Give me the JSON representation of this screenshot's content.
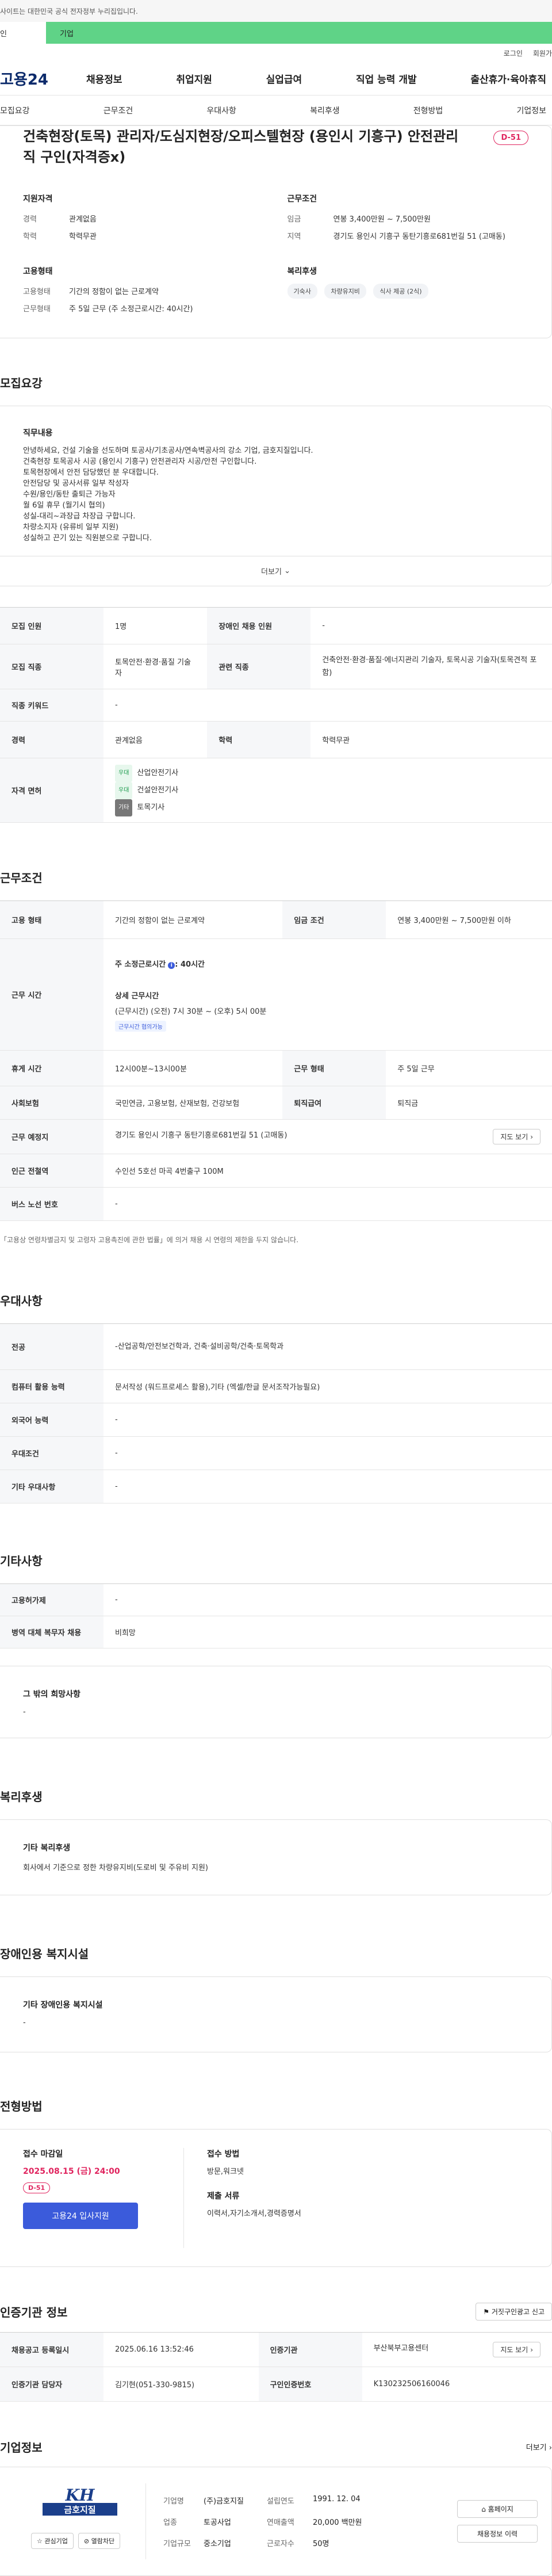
{
  "gov_banner": "사이트는 대한민국 공식 전자정부 누리집입니다.",
  "user_tabs": {
    "personal": "인",
    "corp": "기업"
  },
  "util_links": [
    "로그인",
    "회원가"
  ],
  "logo": "고용24",
  "gnb": [
    "채용정보",
    "취업지원",
    "실업급여",
    "직업 능력 개발",
    "출산휴가·육아휴직"
  ],
  "anchors": [
    "모집요강",
    "근무조건",
    "우대사항",
    "복리후생",
    "전형방법",
    "기업정보"
  ],
  "job": {
    "title": "건축현장(토목) 관리자/도심지현장/오피스텔현장 (용인시 기흥구) 안전관리직 구인(자격증x)",
    "dday": "D-51",
    "qualification_title": "지원자격",
    "career_label": "경력",
    "career_value": "관계없음",
    "edu_label": "학력",
    "edu_value": "학력무관",
    "conditions_title": "근무조건",
    "wage_label": "임금",
    "wage_value": "연봉 3,400만원 ~ 7,500만원",
    "region_label": "지역",
    "region_value": "경기도 용인시 기흥구 동탄기흥로681번길 51 (고매동)",
    "employment_title": "고용형태",
    "emptype_label": "고용형태",
    "emptype_value": "기간의 정함이 없는 근로계약",
    "worktype_label": "근무형태",
    "worktype_value": "주 5일 근무 (주 소정근로시간: 40시간)",
    "welfare_title": "복리후생",
    "welfare_chips": [
      "기숙사",
      "차량유지비",
      "식사 제공 (2식)"
    ]
  },
  "recruit": {
    "section": "모집요강",
    "desc_title": "직무내용",
    "desc_lines": [
      "안녕하세요, 건설 기술을 선도하며 토공사/기초공사/연속벽공사의 강소 기업, 금호지질입니다.",
      "건축현장 토목공사 시공 (용인시 기흥구) 안전관리자 시공/안전 구인합니다.",
      "토목현장에서 안전 담당했던 분 우대합니다.",
      "안전담당 및 공사서류 일부 작성자",
      "수원/용인/동탄 출퇴근 가능자",
      "월 6일 휴무 (월기시 협의)",
      "성실-대리~과장급 차장급 구합니다.",
      "차량소지자 (유류비 일부 지원)",
      "성실하고 끈기 있는 직원분으로 구합니다."
    ],
    "more": "더보기",
    "headcount_label": "모집 인원",
    "headcount_value": "1명",
    "disabled_label": "장애인 채용 인원",
    "disabled_value": "-",
    "job_label": "모집 직종",
    "job_value": "토목안전·환경·품질 기술자",
    "related_label": "관련 직종",
    "related_value": "건축안전·환경·품질·에너지관리 기술자, 토목시공 기술자(토목견적 포함)",
    "keyword_label": "직종 키워드",
    "keyword_value": "-",
    "career_label": "경력",
    "career_value": "관계없음",
    "edu_label": "학력",
    "edu_value": "학력무관",
    "license_label": "자격 면허",
    "licenses": [
      {
        "tag": "우대",
        "name": "산업안전기사"
      },
      {
        "tag": "우대",
        "name": "건설안전기사"
      },
      {
        "tag": "기타",
        "name": "토목기사"
      }
    ]
  },
  "work": {
    "section": "근무조건",
    "emptype_label": "고용 형태",
    "emptype_value": "기간의 정함이 없는 근로계약",
    "wage_label": "임금 조건",
    "wage_value": "연봉 3,400만원 ~ 7,500만원 이하",
    "hours_label": "근무 시간",
    "weekly_hours": "주 소정근로시간",
    "weekly_hours_value": ": 40시간",
    "detail_title": "상세 근무시간",
    "detail_value": "(근무시간) (오전) 7시 30분 ~ (오후) 5시 00분",
    "hint": "근무시간 협의가능",
    "rest_label": "휴게 시간",
    "rest_value": "12시00분~13시00분",
    "worktype_label": "근무 형태",
    "worktype_value": "주 5일 근무",
    "insurance_label": "사회보험",
    "insurance_value": "국민연금, 고용보험, 산재보험, 건강보험",
    "retire_label": "퇴직급여",
    "retire_value": "퇴직금",
    "place_label": "근무 예정지",
    "place_value": "경기도 용인시 기흥구 동탄기흥로681번길 51 (고매동)",
    "map_btn": "지도 보기",
    "station_label": "인근 전철역",
    "station_value": "수인선 5호선 마곡 4번출구 100M",
    "bus_label": "버스 노선 번호",
    "bus_value": "-",
    "note": "「고용상 연령차별금지 및 고령자 고용촉진에 관한 법률」에 의거 채용 시 연령의 제한을 두지 않습니다."
  },
  "prefer": {
    "section": "우대사항",
    "major_label": "전공",
    "major_value": "-산업공학/안전보건학과, 건축·설비공학/건축·토목학과",
    "pc_label": "컴퓨터 활용 능력",
    "pc_value": "문서작성 (워드프로세스 활용),기타 (엑셀/한글 문서조작가능필요)",
    "lang_label": "외국어 능력",
    "lang_value": "-",
    "cond_label": "우대조건",
    "cond_value": "-",
    "etc_label": "기타 우대사항",
    "etc_value": "-"
  },
  "other": {
    "section": "기타사항",
    "support_label": "고용허가제",
    "support_value": "-",
    "military_label": "병역 대체 복무자 채용",
    "military_value": "비희망",
    "wish_title": "그 밖의 희망사항",
    "wish_value": "-"
  },
  "welfare": {
    "section": "복리후생",
    "title": "기타 복리후생",
    "value": "회사에서 기준으로 정한 차량유지비(도로비 및 주유비 지원)"
  },
  "disabled": {
    "section": "장애인용 복지시설",
    "title": "기타 장애인용 복지시설",
    "value": "-"
  },
  "process": {
    "section": "전형방법",
    "deadline_title": "접수 마감일",
    "deadline": "2025.08.15 (금) 24:00",
    "dday": "D-51",
    "apply": "고용24 입사지원",
    "method_title": "접수 방법",
    "method_value": "방문,워크넷",
    "docs_title": "제출 서류",
    "docs_value": "이력서,자기소개서,경력증명서"
  },
  "agency": {
    "section": "인증기관 정보",
    "report": "거짓구인광고 신고",
    "date_label": "채용공고 등록일시",
    "date_value": "2025.06.16 13:52:46",
    "org_label": "인증기관",
    "org_value": "부산북부고용센터",
    "map_btn": "지도 보기",
    "person_label": "인증기관 담당자",
    "person_value": "김기현(051-330-9815)",
    "no_label": "구인인증번호",
    "no_value": "K130232506160046"
  },
  "company": {
    "section": "기업정보",
    "more": "더보기",
    "logo_text_top": "KH",
    "logo_text_bottom": "금호지질",
    "fav": "관심기업",
    "block": "열람차단",
    "name_label": "기업명",
    "name_value": "(주)금호지질",
    "year_label": "설립연도",
    "year_value": "1991. 12. 04",
    "biz_label": "업종",
    "biz_value": "토공사업",
    "sales_label": "연매출액",
    "sales_value": "20,000 백만원",
    "size_label": "기업규모",
    "size_value": "중소기업",
    "staff_label": "근로자수",
    "staff_value": "50명",
    "homepage": "홈페이지",
    "recruit_list": "채용정보 이력"
  }
}
